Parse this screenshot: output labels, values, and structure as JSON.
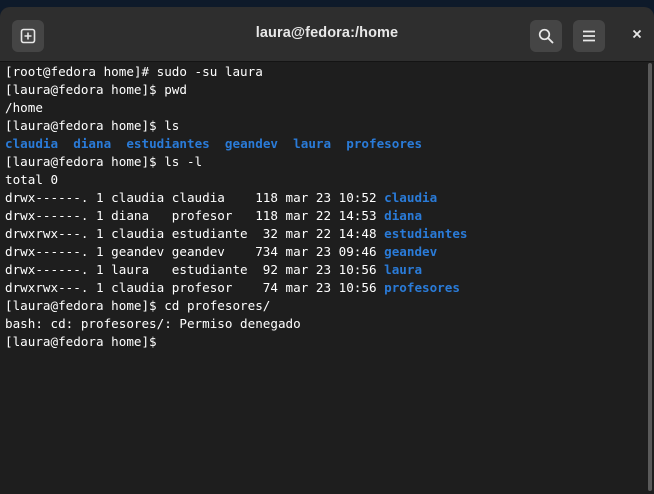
{
  "window": {
    "title": "laura@fedora:/home"
  },
  "icons": {
    "new_tab": "new-tab-icon",
    "search": "search-icon",
    "menu": "hamburger-menu-icon",
    "close": "close-icon"
  },
  "colors": {
    "terminal_bg": "#1e1e1e",
    "titlebar_bg": "#2e2e2e",
    "text": "#ffffff",
    "directory": "#2a7bd8"
  },
  "terminal": {
    "l1": "[root@fedora home]# sudo -su laura",
    "l2": "[laura@fedora home]$ pwd",
    "l3": "/home",
    "l4": "[laura@fedora home]$ ls",
    "ls_dirs": [
      "claudia",
      "diana",
      "estudiantes",
      "geandev",
      "laura",
      "profesores"
    ],
    "l6": "[laura@fedora home]$ ls -l",
    "l7": "total 0",
    "ls_long": [
      {
        "meta": "drwx------. 1 claudia claudia    118 mar 23 10:52 ",
        "name": "claudia"
      },
      {
        "meta": "drwx------. 1 diana   profesor   118 mar 22 14:53 ",
        "name": "diana"
      },
      {
        "meta": "drwxrwx---. 1 claudia estudiante  32 mar 22 14:48 ",
        "name": "estudiantes"
      },
      {
        "meta": "drwx------. 1 geandev geandev    734 mar 23 09:46 ",
        "name": "geandev"
      },
      {
        "meta": "drwx------. 1 laura   estudiante  92 mar 23 10:56 ",
        "name": "laura"
      },
      {
        "meta": "drwxrwx---. 1 claudia profesor    74 mar 23 10:56 ",
        "name": "profesores"
      }
    ],
    "l14": "[laura@fedora home]$ cd profesores/",
    "l15": "bash: cd: profesores/: Permiso denegado",
    "l16": "[laura@fedora home]$ "
  }
}
